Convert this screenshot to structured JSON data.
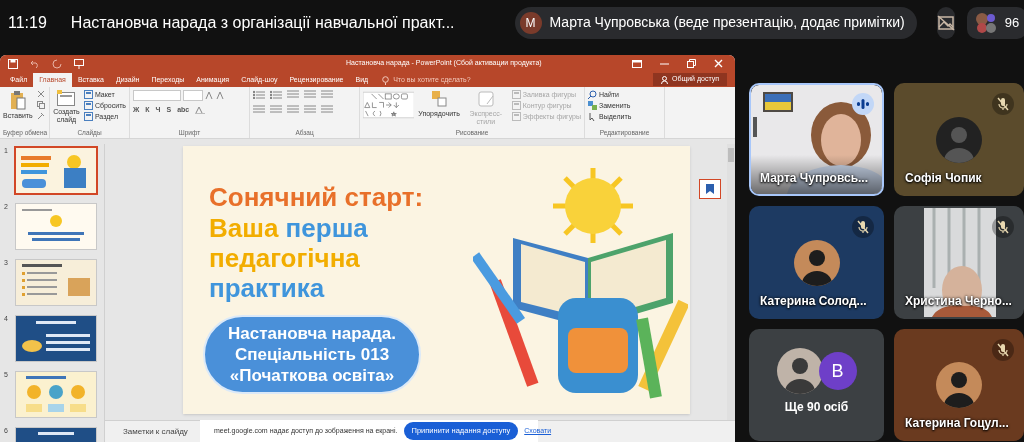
{
  "meeting": {
    "time": "11:19",
    "title": "Настановча нарада з організації навчальної практ...",
    "presenter": {
      "initial": "М",
      "label": "Марта Чупровська (веде презентацію, додає примітки)"
    },
    "participant_count": "96"
  },
  "powerpoint": {
    "title": "Настановча нарада - PowerPoint (Сбой активации продукта)",
    "tabs": [
      {
        "label": "Файл",
        "selected": false
      },
      {
        "label": "Главная",
        "selected": true
      },
      {
        "label": "Вставка",
        "selected": false
      },
      {
        "label": "Дизайн",
        "selected": false
      },
      {
        "label": "Переходы",
        "selected": false
      },
      {
        "label": "Анимация",
        "selected": false
      },
      {
        "label": "Слайд-шоу",
        "selected": false
      },
      {
        "label": "Рецензирование",
        "selected": false
      },
      {
        "label": "Вид",
        "selected": false
      }
    ],
    "tell_me": "Что вы хотите сделать?",
    "share": "Общий доступ",
    "ribbon": [
      {
        "kind": "clipboard",
        "label": "Буфер обмена",
        "items": [
          {
            "label": "Вставить",
            "disabled": false
          }
        ]
      },
      {
        "kind": "slides",
        "label": "Слайды",
        "items": [
          {
            "label": "Создать слайд",
            "disabled": false
          },
          {
            "label": "Макет",
            "disabled": false
          },
          {
            "label": "Сбросить",
            "disabled": false
          },
          {
            "label": "Раздел",
            "disabled": false
          }
        ]
      },
      {
        "kind": "font",
        "label": "Шрифт",
        "items": [
          {
            "label": "Ж",
            "disabled": false
          },
          {
            "label": "К",
            "disabled": false
          },
          {
            "label": "Ч",
            "disabled": false
          },
          {
            "label": "S",
            "disabled": false
          },
          {
            "label": "abc",
            "disabled": false
          }
        ]
      },
      {
        "kind": "paragraph",
        "label": "Абзац"
      },
      {
        "kind": "drawing",
        "label": "Рисование",
        "items": [
          {
            "label": "Упорядочить",
            "disabled": false
          },
          {
            "label": "Экспресс-стили",
            "disabled": true
          },
          {
            "label": "Заливка фигуры",
            "disabled": true
          },
          {
            "label": "Контур фигуры",
            "disabled": true
          },
          {
            "label": "Эффекты фигуры",
            "disabled": true
          }
        ]
      },
      {
        "kind": "editing",
        "label": "Редактирование",
        "items": [
          {
            "label": "Найти",
            "disabled": false
          },
          {
            "label": "Заменить",
            "disabled": false
          },
          {
            "label": "Выделить",
            "disabled": false
          }
        ]
      }
    ],
    "slides": [
      {
        "number": "1",
        "selected": true
      },
      {
        "number": "2",
        "selected": false
      },
      {
        "number": "3",
        "selected": false
      },
      {
        "number": "4",
        "selected": false
      },
      {
        "number": "5",
        "selected": false
      },
      {
        "number": "6",
        "selected": false
      }
    ],
    "slide": {
      "title": "Сонячний старт:",
      "lines": [
        {
          "words": [
            {
              "text": "Ваша",
              "color": "#f2ad00"
            },
            {
              "text": "перша",
              "color": "#3f95dc"
            }
          ]
        },
        {
          "words": [
            {
              "text": "педагогічна",
              "color": "#f2ad00"
            }
          ]
        },
        {
          "words": [
            {
              "text": "практика",
              "color": "#3f95dc"
            }
          ]
        }
      ],
      "pill_lines": [
        "Настановча нарада.",
        "Спеціальність 013",
        "«Початкова освіта»"
      ]
    },
    "notes_placeholder": "Заметки к слайду"
  },
  "share_bar": {
    "message": "meet.google.com надає доступ до зображення на екрані.",
    "stop": "Припинити надання доступу",
    "hide": "Сховати"
  },
  "participants": [
    {
      "kind": "video",
      "name": "Марта Чупровсь...",
      "muted": false,
      "speaking": true
    },
    {
      "kind": "avatar",
      "name": "Софія Чопик",
      "muted": true,
      "speaking": false,
      "color": "#5b4b2c"
    },
    {
      "kind": "avatar",
      "name": "Катерина Солод...",
      "muted": true,
      "speaking": false,
      "color": "#1d3a62"
    },
    {
      "kind": "video",
      "name": "Христина Черно...",
      "muted": true,
      "speaking": false,
      "color": "#3c4043"
    },
    {
      "kind": "overflow",
      "label": "Ще 90 осіб",
      "initial": "B",
      "muted": false,
      "speaking": false,
      "color": "#3c4043"
    },
    {
      "kind": "avatar",
      "name": "Катерина Гоцул...",
      "muted": true,
      "speaking": false,
      "color": "#6a3a1f"
    }
  ]
}
